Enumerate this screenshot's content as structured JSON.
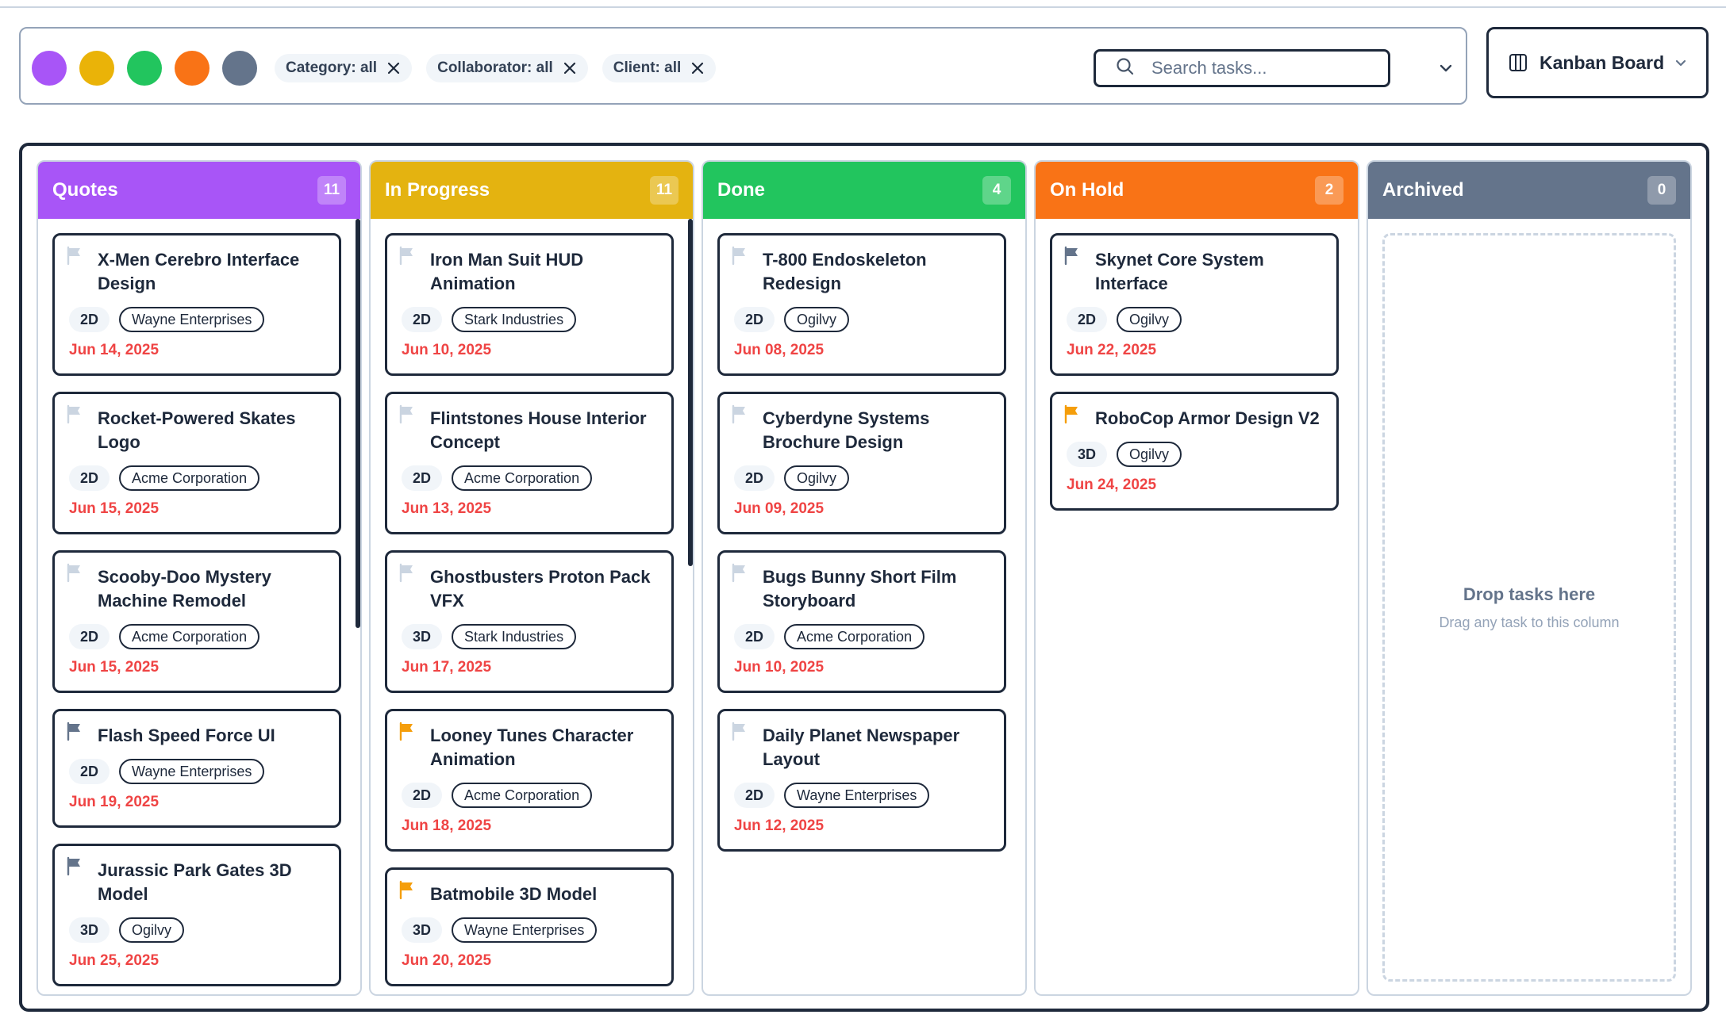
{
  "filters": {
    "color_dots": [
      {
        "name": "purple",
        "color": "#a855f7"
      },
      {
        "name": "yellow",
        "color": "#eab308"
      },
      {
        "name": "green",
        "color": "#22c55e"
      },
      {
        "name": "orange",
        "color": "#f97316"
      },
      {
        "name": "gray",
        "color": "#64748b"
      }
    ],
    "chips": [
      {
        "label": "Category: all"
      },
      {
        "label": "Collaborator: all"
      },
      {
        "label": "Client: all"
      }
    ],
    "search": {
      "placeholder": "Search tasks...",
      "value": ""
    }
  },
  "view_selector": {
    "label": "Kanban Board"
  },
  "colors": {
    "date": "#ef4444",
    "flag_gray": "#64748b",
    "flag_orange": "#f59e0b",
    "flag_none": "#cbd5e1"
  },
  "columns": [
    {
      "title": "Quotes",
      "count": "11",
      "color": "#a855f7",
      "cards": [
        {
          "title": "X-Men Cerebro Interface Design",
          "dim": "2D",
          "client": "Wayne Enterprises",
          "date": "Jun 14, 2025",
          "flag": "none"
        },
        {
          "title": "Rocket-Powered Skates Logo",
          "dim": "2D",
          "client": "Acme Corporation",
          "date": "Jun 15, 2025",
          "flag": "none"
        },
        {
          "title": "Scooby-Doo Mystery Machine Remodel",
          "dim": "2D",
          "client": "Acme Corporation",
          "date": "Jun 15, 2025",
          "flag": "none"
        },
        {
          "title": "Flash Speed Force UI",
          "dim": "2D",
          "client": "Wayne Enterprises",
          "date": "Jun 19, 2025",
          "flag": "gray"
        },
        {
          "title": "Jurassic Park Gates 3D Model",
          "dim": "3D",
          "client": "Ogilvy",
          "date": "Jun 25, 2025",
          "flag": "gray"
        }
      ]
    },
    {
      "title": "In Progress",
      "count": "11",
      "color": "#e4b310",
      "cards": [
        {
          "title": "Iron Man Suit HUD Animation",
          "dim": "2D",
          "client": "Stark Industries",
          "date": "Jun 10, 2025",
          "flag": "none"
        },
        {
          "title": "Flintstones House Interior Concept",
          "dim": "2D",
          "client": "Acme Corporation",
          "date": "Jun 13, 2025",
          "flag": "none"
        },
        {
          "title": "Ghostbusters Proton Pack VFX",
          "dim": "3D",
          "client": "Stark Industries",
          "date": "Jun 17, 2025",
          "flag": "none"
        },
        {
          "title": "Looney Tunes Character Animation",
          "dim": "2D",
          "client": "Acme Corporation",
          "date": "Jun 18, 2025",
          "flag": "orange"
        },
        {
          "title": "Batmobile 3D Model",
          "dim": "3D",
          "client": "Wayne Enterprises",
          "date": "Jun 20, 2025",
          "flag": "orange"
        }
      ]
    },
    {
      "title": "Done",
      "count": "4",
      "color": "#22c55e",
      "cards": [
        {
          "title": "T-800 Endoskeleton Redesign",
          "dim": "2D",
          "client": "Ogilvy",
          "date": "Jun 08, 2025",
          "flag": "none"
        },
        {
          "title": "Cyberdyne Systems Brochure Design",
          "dim": "2D",
          "client": "Ogilvy",
          "date": "Jun 09, 2025",
          "flag": "none"
        },
        {
          "title": "Bugs Bunny Short Film Storyboard",
          "dim": "2D",
          "client": "Acme Corporation",
          "date": "Jun 10, 2025",
          "flag": "none"
        },
        {
          "title": "Daily Planet Newspaper Layout",
          "dim": "2D",
          "client": "Wayne Enterprises",
          "date": "Jun 12, 2025",
          "flag": "none"
        }
      ]
    },
    {
      "title": "On Hold",
      "count": "2",
      "color": "#f97316",
      "cards": [
        {
          "title": "Skynet Core System Interface",
          "dim": "2D",
          "client": "Ogilvy",
          "date": "Jun 22, 2025",
          "flag": "gray"
        },
        {
          "title": "RoboCop Armor Design V2",
          "dim": "3D",
          "client": "Ogilvy",
          "date": "Jun 24, 2025",
          "flag": "orange"
        }
      ]
    },
    {
      "title": "Archived",
      "count": "0",
      "color": "#64748b",
      "cards": [],
      "empty_title": "Drop tasks here",
      "empty_subtitle": "Drag any task to this column"
    }
  ]
}
